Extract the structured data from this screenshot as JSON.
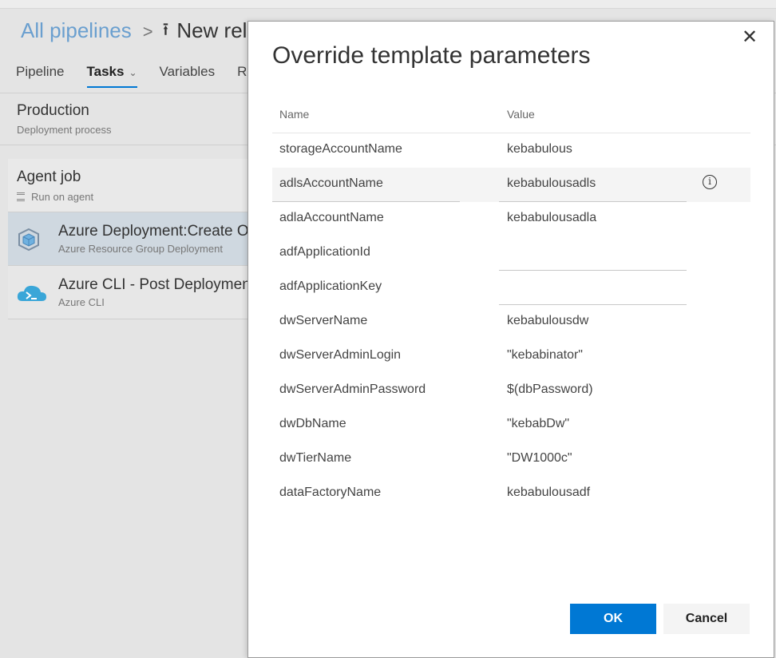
{
  "background": {
    "breadcrumb": {
      "all_pipelines": "All pipelines",
      "separator": ">",
      "current": "New rel"
    },
    "tabs": [
      {
        "label": "Pipeline"
      },
      {
        "label": "Tasks"
      },
      {
        "label": "Variables"
      },
      {
        "label": "R"
      }
    ],
    "tasks_chevron": "⌄",
    "stage": {
      "title": "Production",
      "subtitle": "Deployment process"
    },
    "agent_job": {
      "title": "Agent job",
      "subtitle": "Run on agent"
    },
    "task_items": [
      {
        "title": "Azure Deployment:Create O",
        "subtitle": "Azure Resource Group Deployment",
        "icon": "azure-resource-group-icon"
      },
      {
        "title": "Azure CLI - Post Deploymen",
        "subtitle": "Azure CLI",
        "icon": "azure-cli-icon"
      }
    ]
  },
  "dialog": {
    "title": "Override template parameters",
    "close_icon": "close-icon",
    "columns": {
      "name": "Name",
      "value": "Value"
    },
    "params": [
      {
        "name": "storageAccountName",
        "value": "kebabulous"
      },
      {
        "name": "adlsAccountName",
        "value": "kebabulousadls"
      },
      {
        "name": "adlaAccountName",
        "value": "kebabulousadla"
      },
      {
        "name": "adfApplicationId",
        "value": ""
      },
      {
        "name": "adfApplicationKey",
        "value": ""
      },
      {
        "name": "dwServerName",
        "value": "kebabulousdw"
      },
      {
        "name": "dwServerAdminLogin",
        "value": "\"kebabinator\""
      },
      {
        "name": "dwServerAdminPassword",
        "value": "$(dbPassword)"
      },
      {
        "name": "dwDbName",
        "value": "\"kebabDw\""
      },
      {
        "name": "dwTierName",
        "value": "\"DW1000c\""
      },
      {
        "name": "dataFactoryName",
        "value": "kebabulousadf"
      }
    ],
    "info_icon": "info-icon",
    "buttons": {
      "ok": "OK",
      "cancel": "Cancel"
    },
    "colors": {
      "primary": "#0078d4",
      "dialog_bg": "#ffffff",
      "highlight_row": "#f4f4f4"
    }
  }
}
